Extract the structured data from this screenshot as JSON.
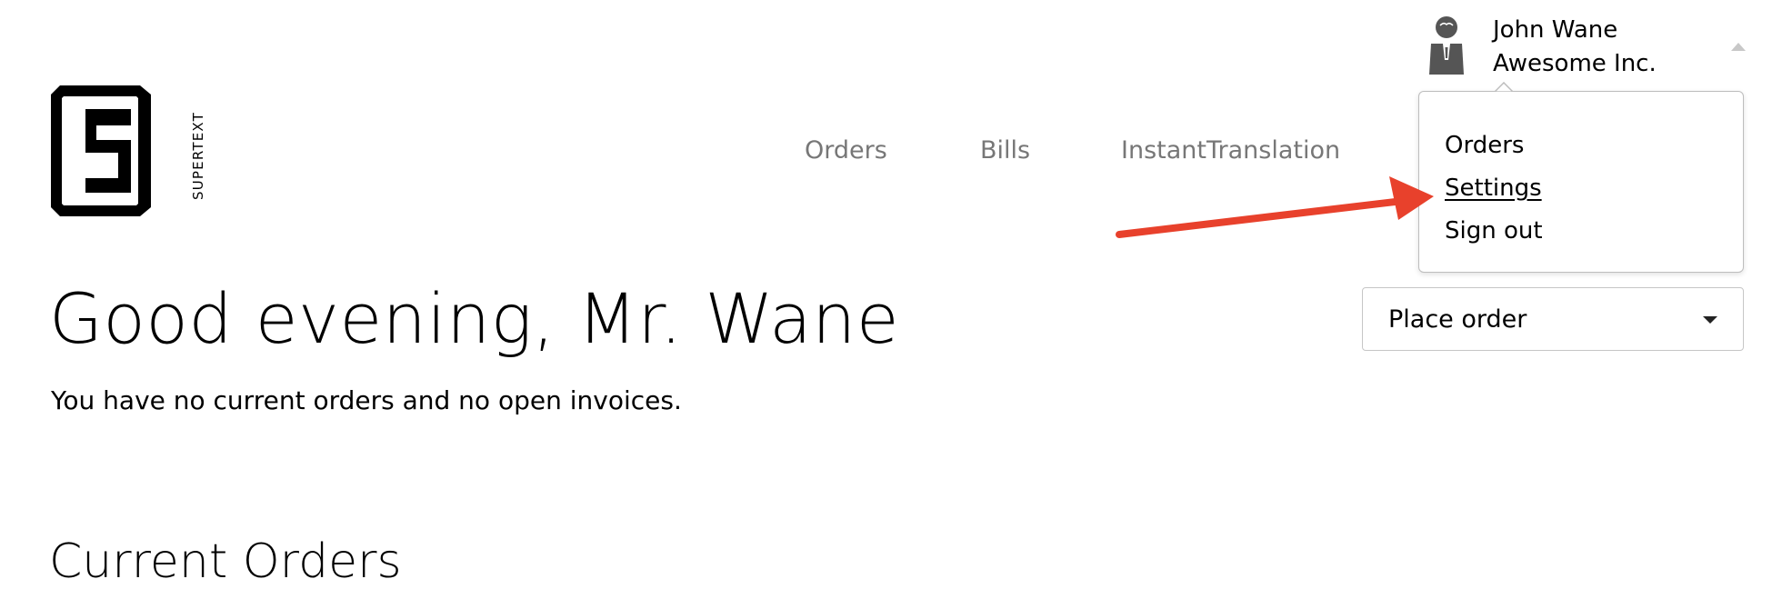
{
  "brand": {
    "logo_text": "SUPERTEXT"
  },
  "nav": {
    "items": [
      {
        "label": "Orders"
      },
      {
        "label": "Bills"
      },
      {
        "label": "InstantTranslation"
      }
    ]
  },
  "user": {
    "name": "John Wane",
    "company": "Awesome Inc."
  },
  "user_menu": {
    "items": [
      {
        "label": "Orders"
      },
      {
        "label": "Settings",
        "active": true
      },
      {
        "label": "Sign out"
      }
    ]
  },
  "main": {
    "greeting": "Good evening, Mr. Wane",
    "status_text": "You have no current orders and no open invoices.",
    "place_order_label": "Place order",
    "current_orders_title": "Current Orders"
  },
  "colors": {
    "annotation_arrow": "#e8412c",
    "nav_text": "#777777",
    "border": "#bdbdbd"
  }
}
